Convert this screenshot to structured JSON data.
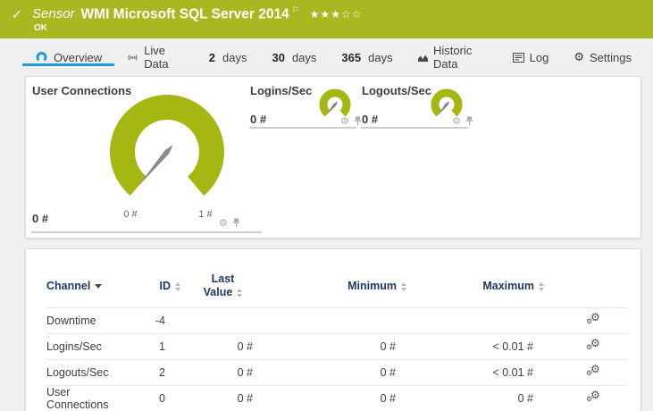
{
  "header": {
    "check": "✓",
    "kind": "Sensor",
    "title": "WMI Microsoft SQL Server 2014",
    "flag": "⚐",
    "stars": "★★★☆☆",
    "status": "OK",
    "bar_color": "#a9b821"
  },
  "tabs": {
    "overview": "Overview",
    "live_data": "Live Data",
    "d2_num": "2",
    "d2_label": "days",
    "d30_num": "30",
    "d30_label": "days",
    "d365_num": "365",
    "d365_label": "days",
    "historic": "Historic Data",
    "log": "Log",
    "settings": "Settings",
    "settings_gear": "⚙",
    "active_color": "#1e9dd8"
  },
  "gauges": {
    "color": "#a4b712",
    "needle_color": "#8a8a8a",
    "gear_glyph": "⚙",
    "main": {
      "title": "User Connections",
      "value": "0 #",
      "scale_min": "0 #",
      "scale_max": "1 #"
    },
    "logins": {
      "title": "Logins/Sec",
      "value": "0 #"
    },
    "logouts": {
      "title": "Logouts/Sec",
      "value": "0 #"
    }
  },
  "table": {
    "gear_glyph": "⚙",
    "headers": {
      "channel": "Channel",
      "id": "ID",
      "last": "Last Value",
      "min": "Minimum",
      "max": "Maximum"
    },
    "rows": [
      {
        "channel": "Downtime",
        "id": "-4",
        "last": "",
        "min": "",
        "max": ""
      },
      {
        "channel": "Logins/Sec",
        "id": "1",
        "last": "0 #",
        "min": "0 #",
        "max": "< 0.01 #"
      },
      {
        "channel": "Logouts/Sec",
        "id": "2",
        "last": "0 #",
        "min": "0 #",
        "max": "< 0.01 #"
      },
      {
        "channel": "User Connections",
        "id": "0",
        "last": "0 #",
        "min": "0 #",
        "max": "0 #"
      }
    ]
  }
}
